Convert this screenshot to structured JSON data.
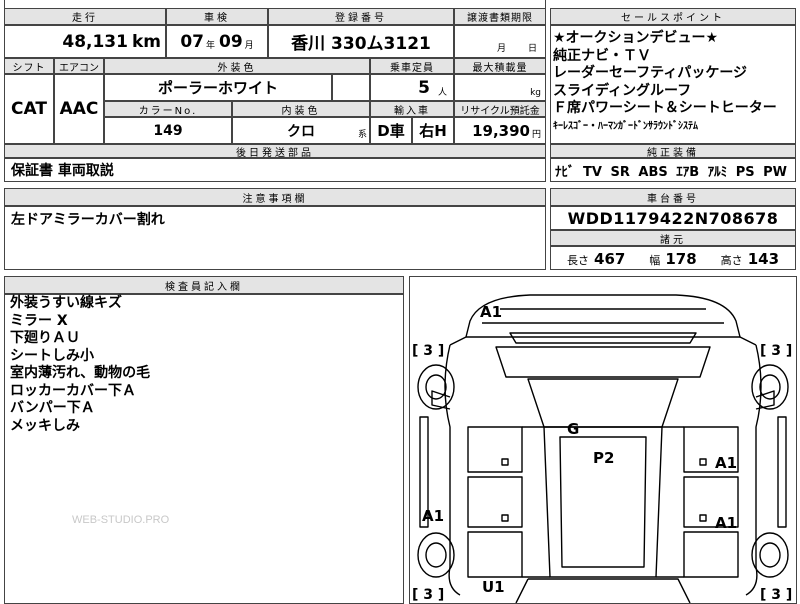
{
  "header": {
    "mileage_label": "走行",
    "mileage_value": "48,131",
    "mileage_unit": "km",
    "inspection_label": "車検",
    "inspection_year": "07",
    "inspection_year_unit": "年",
    "inspection_month": "09",
    "inspection_month_unit": "月",
    "registration_label": "登録番号",
    "registration_value": "香川 330ム3121",
    "transfer_label": "譲渡書類期限",
    "transfer_month_unit": "月",
    "transfer_day_unit": "日"
  },
  "specs": {
    "shift_label": "シフト",
    "shift_value": "CAT",
    "aircon_label": "エアコン",
    "aircon_value": "AAC",
    "exterior_label": "外装色",
    "exterior_value": "ポーラーホワイト",
    "capacity_label": "乗車定員",
    "capacity_value": "5",
    "capacity_unit": "人",
    "load_label": "最大積載量",
    "load_unit": "kg",
    "color_no_label": "カラーNo.",
    "color_no_value": "149",
    "interior_label": "内装色",
    "interior_value": "クロ",
    "interior_unit": "系",
    "import_label": "輸入車",
    "import_d": "D車",
    "import_h": "右H",
    "recycle_label": "リサイクル預託金",
    "recycle_value": "19,390",
    "recycle_unit": "円"
  },
  "sales_points": {
    "label": "セールスポイント",
    "lines": [
      "★オークションデビュー★",
      "純正ナビ・ＴＶ",
      "レーダーセーフティパッケージ",
      "スライディングルーフ",
      "Ｆ席パワーシート＆シートヒーター",
      "ｷｰﾚｽｺﾞｰ・ﾊｰﾏﾝｶﾞｰﾄﾞﾝｻﾗｳﾝﾄﾞｼｽﾃﾑ"
    ]
  },
  "later_parts": {
    "label": "後日発送部品",
    "value": "保証書 車両取説"
  },
  "equipment": {
    "label": "純正装備",
    "value": "ﾅﾋﾞ TV SR ABS ｴｱB ｱﾙﾐ PS PW"
  },
  "notes": {
    "label": "注意事項欄",
    "value": "左ドアミラーカバー割れ"
  },
  "vin": {
    "label": "車台番号",
    "value": "WDD1179422N708678"
  },
  "dimensions": {
    "label": "諸元",
    "length_label": "長さ",
    "length_value": "467",
    "width_label": "幅",
    "width_value": "178",
    "height_label": "高さ",
    "height_value": "143"
  },
  "inspector": {
    "label": "検査員記入欄",
    "lines": [
      "外装うすい線キズ",
      "ミラー X",
      "下廻りＡＵ",
      "シートしみ小",
      "室内薄汚れ、動物の毛",
      "ロッカーカバー下Ａ",
      "バンパー下Ａ",
      "メッキしみ"
    ]
  },
  "watermark": "WEB-STUDIO.PRO",
  "diagram": {
    "marks": {
      "a1_top": "A1",
      "g": "G",
      "p2": "P2",
      "a1_right_upper": "A1",
      "a1_right_lower": "A1",
      "a1_left": "A1",
      "u1": "U1"
    },
    "tread": {
      "tl": "[ 3 ]",
      "tr": "[ 3 ]",
      "bl": "[ 3 ]",
      "br": "[ 3 ]"
    }
  }
}
